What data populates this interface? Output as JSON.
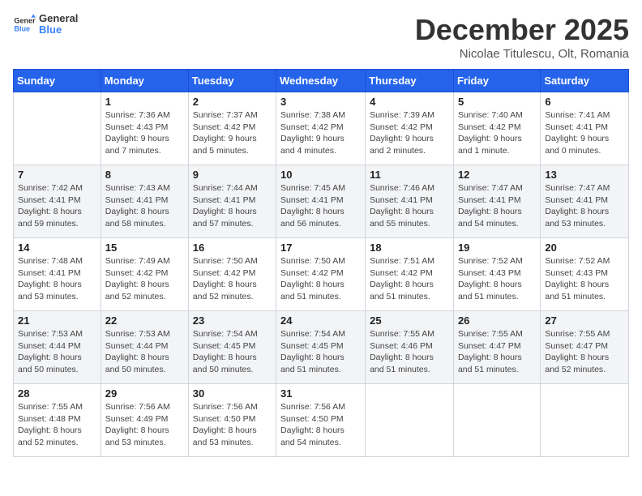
{
  "logo": {
    "general": "General",
    "blue": "Blue"
  },
  "title": "December 2025",
  "subtitle": "Nicolae Titulescu, Olt, Romania",
  "days_of_week": [
    "Sunday",
    "Monday",
    "Tuesday",
    "Wednesday",
    "Thursday",
    "Friday",
    "Saturday"
  ],
  "weeks": [
    [
      {
        "day": "",
        "info": ""
      },
      {
        "day": "1",
        "sunrise": "7:36 AM",
        "sunset": "4:43 PM",
        "daylight": "9 hours and 7 minutes."
      },
      {
        "day": "2",
        "sunrise": "7:37 AM",
        "sunset": "4:42 PM",
        "daylight": "9 hours and 5 minutes."
      },
      {
        "day": "3",
        "sunrise": "7:38 AM",
        "sunset": "4:42 PM",
        "daylight": "9 hours and 4 minutes."
      },
      {
        "day": "4",
        "sunrise": "7:39 AM",
        "sunset": "4:42 PM",
        "daylight": "9 hours and 2 minutes."
      },
      {
        "day": "5",
        "sunrise": "7:40 AM",
        "sunset": "4:42 PM",
        "daylight": "9 hours and 1 minute."
      },
      {
        "day": "6",
        "sunrise": "7:41 AM",
        "sunset": "4:41 PM",
        "daylight": "9 hours and 0 minutes."
      }
    ],
    [
      {
        "day": "7",
        "sunrise": "7:42 AM",
        "sunset": "4:41 PM",
        "daylight": "8 hours and 59 minutes."
      },
      {
        "day": "8",
        "sunrise": "7:43 AM",
        "sunset": "4:41 PM",
        "daylight": "8 hours and 58 minutes."
      },
      {
        "day": "9",
        "sunrise": "7:44 AM",
        "sunset": "4:41 PM",
        "daylight": "8 hours and 57 minutes."
      },
      {
        "day": "10",
        "sunrise": "7:45 AM",
        "sunset": "4:41 PM",
        "daylight": "8 hours and 56 minutes."
      },
      {
        "day": "11",
        "sunrise": "7:46 AM",
        "sunset": "4:41 PM",
        "daylight": "8 hours and 55 minutes."
      },
      {
        "day": "12",
        "sunrise": "7:47 AM",
        "sunset": "4:41 PM",
        "daylight": "8 hours and 54 minutes."
      },
      {
        "day": "13",
        "sunrise": "7:47 AM",
        "sunset": "4:41 PM",
        "daylight": "8 hours and 53 minutes."
      }
    ],
    [
      {
        "day": "14",
        "sunrise": "7:48 AM",
        "sunset": "4:41 PM",
        "daylight": "8 hours and 53 minutes."
      },
      {
        "day": "15",
        "sunrise": "7:49 AM",
        "sunset": "4:42 PM",
        "daylight": "8 hours and 52 minutes."
      },
      {
        "day": "16",
        "sunrise": "7:50 AM",
        "sunset": "4:42 PM",
        "daylight": "8 hours and 52 minutes."
      },
      {
        "day": "17",
        "sunrise": "7:50 AM",
        "sunset": "4:42 PM",
        "daylight": "8 hours and 51 minutes."
      },
      {
        "day": "18",
        "sunrise": "7:51 AM",
        "sunset": "4:42 PM",
        "daylight": "8 hours and 51 minutes."
      },
      {
        "day": "19",
        "sunrise": "7:52 AM",
        "sunset": "4:43 PM",
        "daylight": "8 hours and 51 minutes."
      },
      {
        "day": "20",
        "sunrise": "7:52 AM",
        "sunset": "4:43 PM",
        "daylight": "8 hours and 51 minutes."
      }
    ],
    [
      {
        "day": "21",
        "sunrise": "7:53 AM",
        "sunset": "4:44 PM",
        "daylight": "8 hours and 50 minutes."
      },
      {
        "day": "22",
        "sunrise": "7:53 AM",
        "sunset": "4:44 PM",
        "daylight": "8 hours and 50 minutes."
      },
      {
        "day": "23",
        "sunrise": "7:54 AM",
        "sunset": "4:45 PM",
        "daylight": "8 hours and 50 minutes."
      },
      {
        "day": "24",
        "sunrise": "7:54 AM",
        "sunset": "4:45 PM",
        "daylight": "8 hours and 51 minutes."
      },
      {
        "day": "25",
        "sunrise": "7:55 AM",
        "sunset": "4:46 PM",
        "daylight": "8 hours and 51 minutes."
      },
      {
        "day": "26",
        "sunrise": "7:55 AM",
        "sunset": "4:47 PM",
        "daylight": "8 hours and 51 minutes."
      },
      {
        "day": "27",
        "sunrise": "7:55 AM",
        "sunset": "4:47 PM",
        "daylight": "8 hours and 52 minutes."
      }
    ],
    [
      {
        "day": "28",
        "sunrise": "7:55 AM",
        "sunset": "4:48 PM",
        "daylight": "8 hours and 52 minutes."
      },
      {
        "day": "29",
        "sunrise": "7:56 AM",
        "sunset": "4:49 PM",
        "daylight": "8 hours and 53 minutes."
      },
      {
        "day": "30",
        "sunrise": "7:56 AM",
        "sunset": "4:50 PM",
        "daylight": "8 hours and 53 minutes."
      },
      {
        "day": "31",
        "sunrise": "7:56 AM",
        "sunset": "4:50 PM",
        "daylight": "8 hours and 54 minutes."
      },
      {
        "day": "",
        "info": ""
      },
      {
        "day": "",
        "info": ""
      },
      {
        "day": "",
        "info": ""
      }
    ]
  ]
}
